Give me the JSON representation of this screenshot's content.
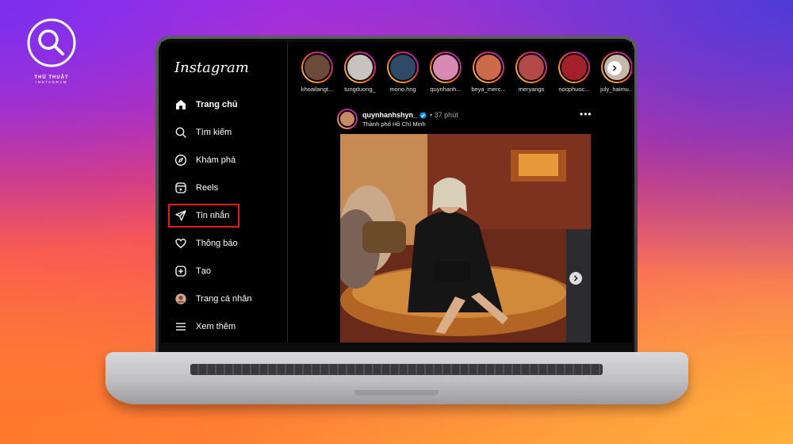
{
  "brand": {
    "line1": "THỦ THUẬT",
    "line2": "INSTAGRAM"
  },
  "app": {
    "logo_text": "Instagram"
  },
  "nav": [
    {
      "label": "Trang chủ",
      "icon": "home-icon",
      "active": true
    },
    {
      "label": "Tìm kiếm",
      "icon": "search-icon"
    },
    {
      "label": "Khám phá",
      "icon": "compass-icon"
    },
    {
      "label": "Reels",
      "icon": "reels-icon"
    },
    {
      "label": "Tin nhắn",
      "icon": "messenger-icon",
      "highlighted": true
    },
    {
      "label": "Thông báo",
      "icon": "heart-icon"
    },
    {
      "label": "Tạo",
      "icon": "plus-square-icon"
    },
    {
      "label": "Trang cá nhân",
      "icon": "avatar-icon"
    },
    {
      "label": "Xem thêm",
      "icon": "menu-icon"
    }
  ],
  "stories": [
    {
      "name": "khoailangt...",
      "color": "#6b4a3a"
    },
    {
      "name": "tungduong_",
      "color": "#c9c3c0"
    },
    {
      "name": "mono.hng",
      "color": "#2f4a66"
    },
    {
      "name": "quynhanh...",
      "color": "#d88ab4"
    },
    {
      "name": "beya_merc...",
      "color": "#cc6a4a"
    },
    {
      "name": "meryangs",
      "color": "#b24a4a"
    },
    {
      "name": "noophuoc...",
      "color": "#a31f2a"
    },
    {
      "name": "july_haimu...",
      "color": "#c7b7a7"
    }
  ],
  "post": {
    "username": "quynhanhshyn_",
    "time": "• 37 phút",
    "location": "Thành phố Hồ Chí Minh",
    "more_label": "•••"
  },
  "colors": {
    "highlight": "#e21b1b",
    "background": "#000000",
    "text": "#ffffff"
  }
}
